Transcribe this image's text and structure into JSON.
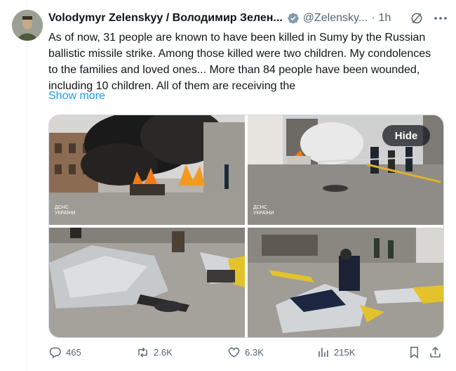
{
  "author": {
    "display_name": "Volodymyr Zelenskyy / Володимир Зелен...",
    "handle": "@Zelensky...",
    "separator": "·",
    "time": "1h"
  },
  "tweet": {
    "text": "As of now, 31 people are known to have been killed in Sumy by the Russian ballistic missile strike. Among those killed were two children. My condolences to the families and loved ones... More than 84 people have been wounded, including 10 children. All of them are receiving the",
    "show_more": "Show more"
  },
  "media": {
    "hide_label": "Hide",
    "watermark_line1": "ДСНС",
    "watermark_line2": "УКРАЇНИ"
  },
  "actions": {
    "replies": "465",
    "reposts": "2.6K",
    "likes": "6.3K",
    "views": "215K"
  },
  "colors": {
    "accent": "#1d9bf0",
    "secondary_text": "#536471"
  },
  "icons": [
    "verified-badge-icon",
    "grok-icon",
    "more-icon",
    "reply-icon",
    "repost-icon",
    "like-icon",
    "views-icon",
    "bookmark-icon",
    "share-icon"
  ]
}
